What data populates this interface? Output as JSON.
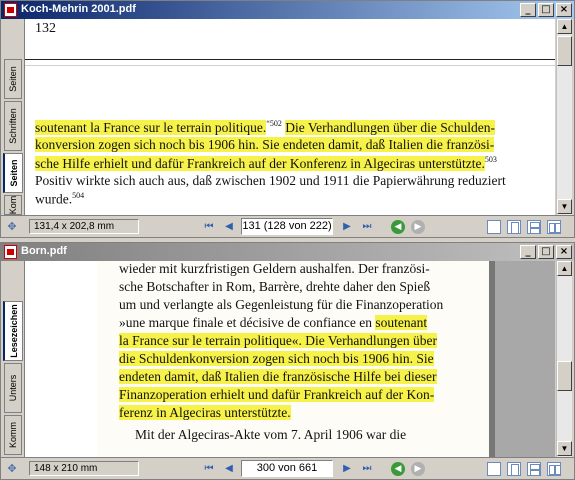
{
  "window1": {
    "title": "Koch-Mehrin 2001.pdf",
    "tabs": [
      "Seiten",
      "Schriften",
      "Seiten",
      "Kom"
    ],
    "page_number_top": "132",
    "text_lines": [
      {
        "pre": "",
        "hl": "soutenant la France sur le terrain politique.",
        "sup1": "“502",
        "gap": " ",
        "hl2": "Die Verhandlungen über die Schulden-",
        "post": ""
      },
      {
        "pre": "",
        "hl": "konversion zogen sich noch bis 1906 hin. Sie endeten damit, daß Italien die französi-",
        "post": ""
      },
      {
        "pre": "",
        "hl": "sche Hilfe erhielt und dafür Frankreich auf der Konferenz in Algeciras unterstützte.",
        "sup": "503",
        "post": ""
      },
      {
        "pre": "Positiv wirkte sich auch aus, daß zwischen 1902 und 1911 die Papierwährung reduziert",
        "hl": "",
        "post": ""
      },
      {
        "pre": "wurde.",
        "sup": "504",
        "hl": "",
        "post": ""
      }
    ],
    "size": "131,4 x 202,8 mm",
    "page_field": "131  (128 von 222)"
  },
  "window2": {
    "title": "Born.pdf",
    "tabs": [
      "Lesezeichen",
      "Unters",
      "Komm"
    ],
    "text_lines": [
      {
        "pre": "wieder mit kurzfristigen Geldern aushalfen. Der französi-",
        "hl": ""
      },
      {
        "pre": "sche Botschafter in Rom, Barrère, drehte daher den Spieß",
        "hl": ""
      },
      {
        "pre": "um und verlangte als Gegenleistung für die Finanzoperation",
        "hl": ""
      },
      {
        "pre": "»une marque finale et décisive de confiance en ",
        "hl": "soutenant"
      },
      {
        "pre": "",
        "hl": "la France sur le terrain politique«. Die Verhandlungen über"
      },
      {
        "pre": "",
        "hl": "die Schuldenkonversion zogen sich noch bis 1906 hin. Sie"
      },
      {
        "pre": "",
        "hl": "endeten damit, daß Italien die französische Hilfe bei dieser"
      },
      {
        "pre": "",
        "hl": "Finanzoperation erhielt und dafür  Frankreich auf der Kon-"
      },
      {
        "pre": "",
        "hl": "ferenz in Algeciras unterstützte."
      },
      {
        "pre": "Mit der Algeciras-Akte vom 7. April 1906 war die",
        "hl": ""
      }
    ],
    "size": "148 x 210 mm",
    "page_field": "300 von 661"
  },
  "colors": {
    "highlight": "#f6f24a",
    "titlebar_active": "#0a246a",
    "nav_icon": "#2f5fb0",
    "go_button": "#3a9a3a",
    "back_button": "#b0b0b0"
  },
  "icons": {
    "first": "first-page-icon",
    "prev": "previous-page-icon",
    "next": "next-page-icon",
    "last": "last-page-icon",
    "back": "back-icon",
    "forward": "forward-icon"
  }
}
